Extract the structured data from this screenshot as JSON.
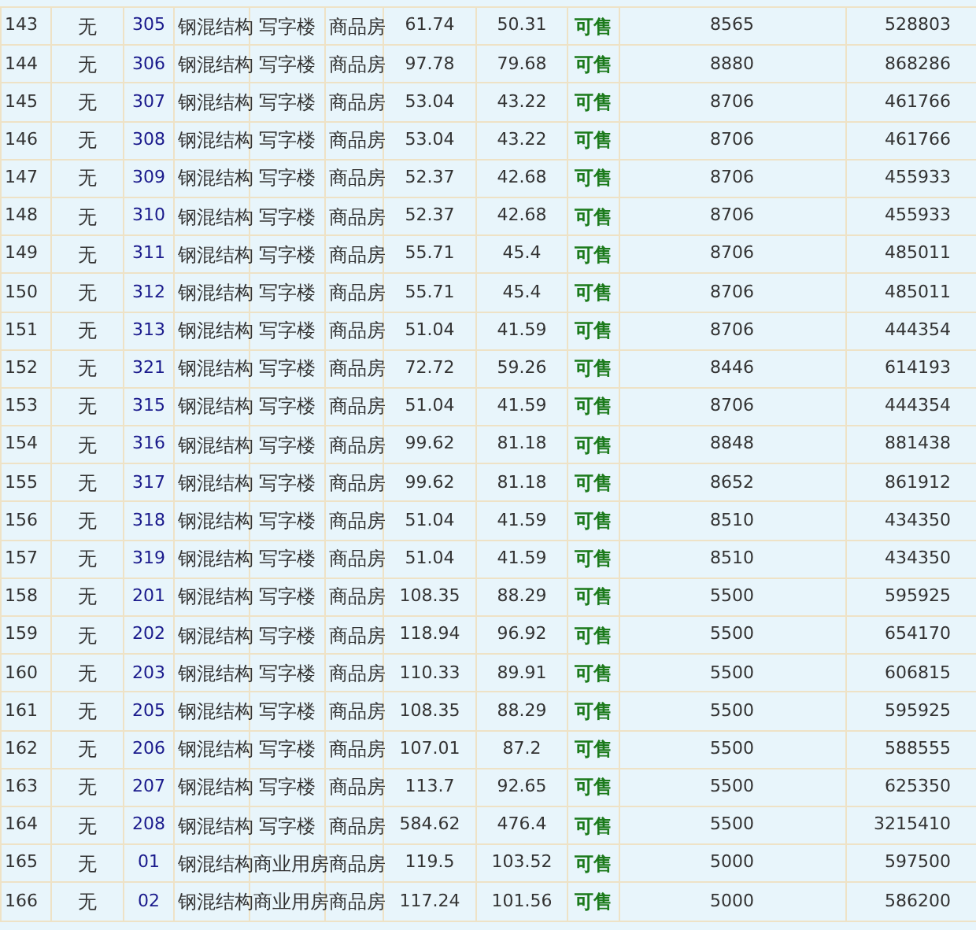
{
  "table": {
    "rows": [
      [
        "143",
        "无",
        "305",
        "钢混结构",
        "写字楼",
        "商品房",
        "61.74",
        "50.31",
        "可售",
        "8565",
        "528803"
      ],
      [
        "144",
        "无",
        "306",
        "钢混结构",
        "写字楼",
        "商品房",
        "97.78",
        "79.68",
        "可售",
        "8880",
        "868286"
      ],
      [
        "145",
        "无",
        "307",
        "钢混结构",
        "写字楼",
        "商品房",
        "53.04",
        "43.22",
        "可售",
        "8706",
        "461766"
      ],
      [
        "146",
        "无",
        "308",
        "钢混结构",
        "写字楼",
        "商品房",
        "53.04",
        "43.22",
        "可售",
        "8706",
        "461766"
      ],
      [
        "147",
        "无",
        "309",
        "钢混结构",
        "写字楼",
        "商品房",
        "52.37",
        "42.68",
        "可售",
        "8706",
        "455933"
      ],
      [
        "148",
        "无",
        "310",
        "钢混结构",
        "写字楼",
        "商品房",
        "52.37",
        "42.68",
        "可售",
        "8706",
        "455933"
      ],
      [
        "149",
        "无",
        "311",
        "钢混结构",
        "写字楼",
        "商品房",
        "55.71",
        "45.4",
        "可售",
        "8706",
        "485011"
      ],
      [
        "150",
        "无",
        "312",
        "钢混结构",
        "写字楼",
        "商品房",
        "55.71",
        "45.4",
        "可售",
        "8706",
        "485011"
      ],
      [
        "151",
        "无",
        "313",
        "钢混结构",
        "写字楼",
        "商品房",
        "51.04",
        "41.59",
        "可售",
        "8706",
        "444354"
      ],
      [
        "152",
        "无",
        "321",
        "钢混结构",
        "写字楼",
        "商品房",
        "72.72",
        "59.26",
        "可售",
        "8446",
        "614193"
      ],
      [
        "153",
        "无",
        "315",
        "钢混结构",
        "写字楼",
        "商品房",
        "51.04",
        "41.59",
        "可售",
        "8706",
        "444354"
      ],
      [
        "154",
        "无",
        "316",
        "钢混结构",
        "写字楼",
        "商品房",
        "99.62",
        "81.18",
        "可售",
        "8848",
        "881438"
      ],
      [
        "155",
        "无",
        "317",
        "钢混结构",
        "写字楼",
        "商品房",
        "99.62",
        "81.18",
        "可售",
        "8652",
        "861912"
      ],
      [
        "156",
        "无",
        "318",
        "钢混结构",
        "写字楼",
        "商品房",
        "51.04",
        "41.59",
        "可售",
        "8510",
        "434350"
      ],
      [
        "157",
        "无",
        "319",
        "钢混结构",
        "写字楼",
        "商品房",
        "51.04",
        "41.59",
        "可售",
        "8510",
        "434350"
      ],
      [
        "158",
        "无",
        "201",
        "钢混结构",
        "写字楼",
        "商品房",
        "108.35",
        "88.29",
        "可售",
        "5500",
        "595925"
      ],
      [
        "159",
        "无",
        "202",
        "钢混结构",
        "写字楼",
        "商品房",
        "118.94",
        "96.92",
        "可售",
        "5500",
        "654170"
      ],
      [
        "160",
        "无",
        "203",
        "钢混结构",
        "写字楼",
        "商品房",
        "110.33",
        "89.91",
        "可售",
        "5500",
        "606815"
      ],
      [
        "161",
        "无",
        "205",
        "钢混结构",
        "写字楼",
        "商品房",
        "108.35",
        "88.29",
        "可售",
        "5500",
        "595925"
      ],
      [
        "162",
        "无",
        "206",
        "钢混结构",
        "写字楼",
        "商品房",
        "107.01",
        "87.2",
        "可售",
        "5500",
        "588555"
      ],
      [
        "163",
        "无",
        "207",
        "钢混结构",
        "写字楼",
        "商品房",
        "113.7",
        "92.65",
        "可售",
        "5500",
        "625350"
      ],
      [
        "164",
        "无",
        "208",
        "钢混结构",
        "写字楼",
        "商品房",
        "584.62",
        "476.4",
        "可售",
        "5500",
        "3215410"
      ],
      [
        "165",
        "无",
        "01",
        "钢混结构",
        "商业用房",
        "商品房",
        "119.5",
        "103.52",
        "可售",
        "5000",
        "597500"
      ],
      [
        "166",
        "无",
        "02",
        "钢混结构",
        "商业用房",
        "商品房",
        "117.24",
        "101.56",
        "可售",
        "5000",
        "586200"
      ]
    ]
  }
}
